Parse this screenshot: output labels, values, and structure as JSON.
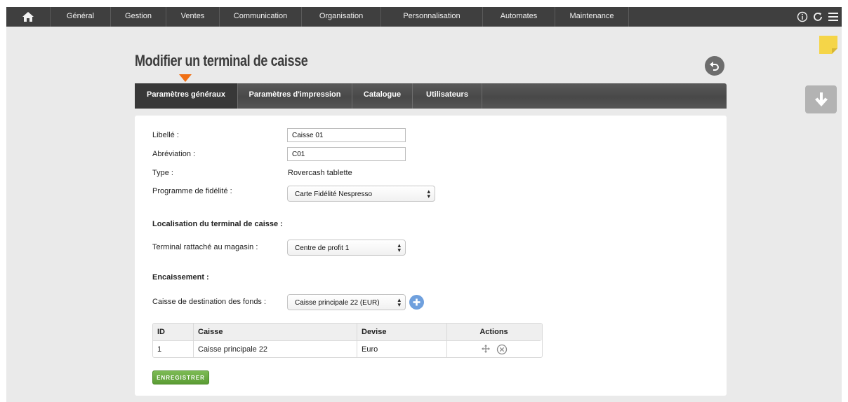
{
  "nav": {
    "items": [
      {
        "label": "Général"
      },
      {
        "label": "Gestion"
      },
      {
        "label": "Ventes"
      },
      {
        "label": "Communication"
      },
      {
        "label": "Organisation"
      },
      {
        "label": "Personnalisation"
      },
      {
        "label": "Automates"
      },
      {
        "label": "Maintenance"
      }
    ]
  },
  "page": {
    "title": "Modifier un terminal de caisse"
  },
  "tabs": [
    {
      "label": "Paramètres généraux",
      "active": true
    },
    {
      "label": "Paramètres d'impression"
    },
    {
      "label": "Catalogue"
    },
    {
      "label": "Utilisateurs"
    }
  ],
  "form": {
    "libelle": {
      "label": "Libellé :",
      "value": "Caisse 01"
    },
    "abreviation": {
      "label": "Abréviation :",
      "value": "C01"
    },
    "type": {
      "label": "Type :",
      "value": "Rovercash tablette"
    },
    "fidelite": {
      "label": "Programme de fidélité :",
      "value": "Carte Fidélité Nespresso"
    },
    "localisation_heading": "Localisation du terminal de caisse :",
    "magasin": {
      "label": "Terminal rattaché au magasin :",
      "value": "Centre de profit 1"
    },
    "encaissement_heading": "Encaissement :",
    "destination": {
      "label": "Caisse de destination des fonds :",
      "value": "Caisse principale 22 (EUR)"
    }
  },
  "table": {
    "headers": {
      "id": "ID",
      "caisse": "Caisse",
      "devise": "Devise",
      "actions": "Actions"
    },
    "rows": [
      {
        "id": "1",
        "caisse": "Caisse principale 22",
        "devise": "Euro"
      }
    ]
  },
  "save_label": "ENREGISTRER",
  "colors": {
    "accent": "#f07015",
    "nav_bg": "#3f3f3f",
    "save_green": "#5a9c34",
    "plus_blue": "#6fa0dd"
  }
}
